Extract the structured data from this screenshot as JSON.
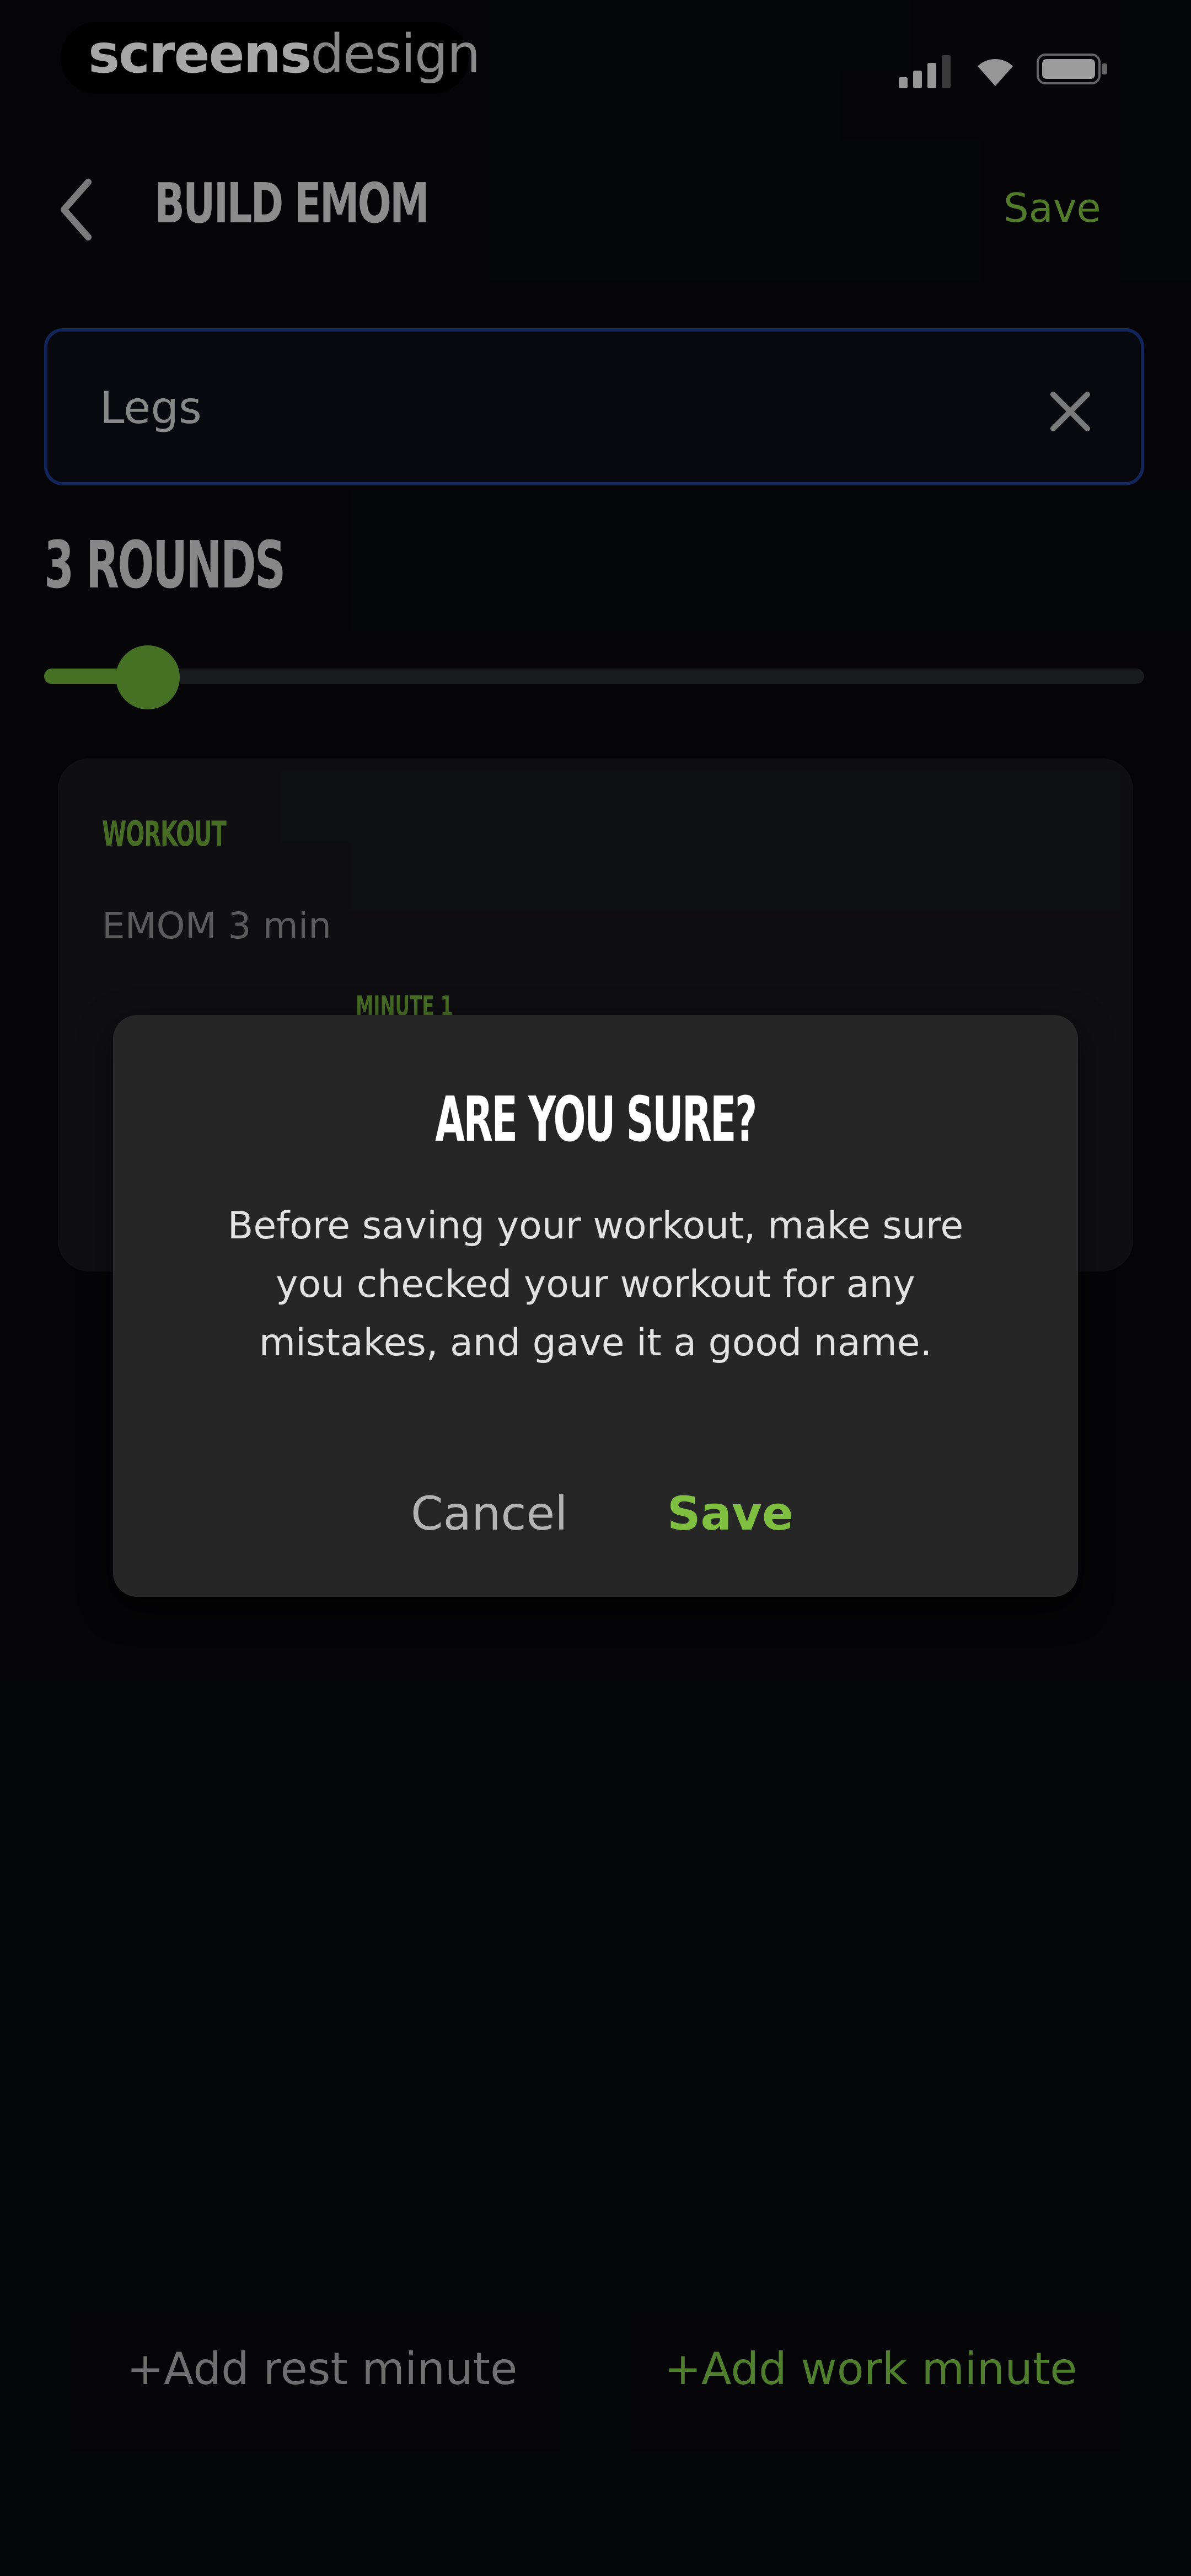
{
  "status_bar": {
    "brand_bold": "screens",
    "brand_light": "design"
  },
  "header": {
    "title": "BUILD EMOM",
    "save_label": "Save"
  },
  "name_input": {
    "value": "Legs"
  },
  "rounds": {
    "label": "3 ROUNDS",
    "slider_value": 3,
    "slider_min": 1,
    "slider_max": 30
  },
  "workout_card": {
    "section_label": "WORKOUT",
    "summary": "EMOM 3 min",
    "minute_chip": "MINUTE 1"
  },
  "dialog": {
    "title": "ARE YOU SURE?",
    "body": "Before saving your workout, make sure you checked your workout for any mistakes, and gave it a good name.",
    "cancel_label": "Cancel",
    "save_label": "Save"
  },
  "bottom_actions": {
    "add_rest": "+Add rest minute",
    "add_work": "+Add work minute"
  },
  "colors": {
    "accent_green": "#7fbf3f",
    "input_border": "#1c3a8a",
    "dialog_bg": "#262626",
    "background": "#08090b"
  }
}
